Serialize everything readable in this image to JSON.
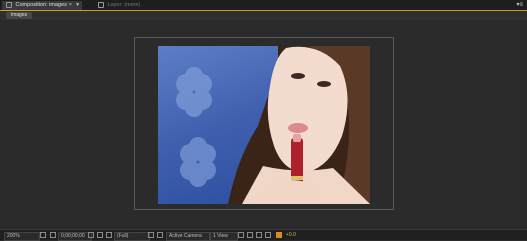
{
  "panel": {
    "active_tab": "Composition: images",
    "active_tab_close": "×",
    "tab_dropdown": "▾",
    "inactive_tab": "Layer: (none)",
    "panel_menu": "▾≡",
    "subtab": "images"
  },
  "statusbar": {
    "zoom": "200%",
    "timecode": "0;00;00;00",
    "resolution": "(Full)",
    "view": "Active Camera",
    "layout": "1 View",
    "exposure": "+0.0"
  },
  "colors": {
    "accent": "#c9a227",
    "background": "#2b2b2b",
    "exposure_value": "#d9b14a"
  }
}
